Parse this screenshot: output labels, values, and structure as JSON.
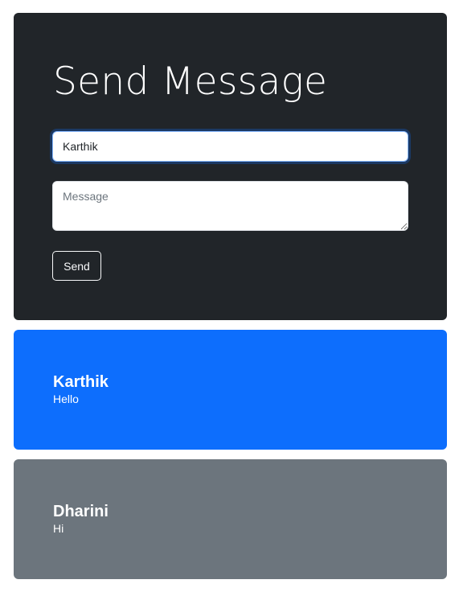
{
  "form": {
    "title": "Send Message",
    "name_value": "Karthik",
    "message_placeholder": "Message",
    "send_label": "Send"
  },
  "messages": [
    {
      "sender": "Karthik",
      "text": "Hello",
      "color": "#0d6efd"
    },
    {
      "sender": "Dharini",
      "text": "Hi",
      "color": "#6c757d"
    }
  ],
  "colors": {
    "form_background": "#212529",
    "page_background": "#ffffff"
  }
}
